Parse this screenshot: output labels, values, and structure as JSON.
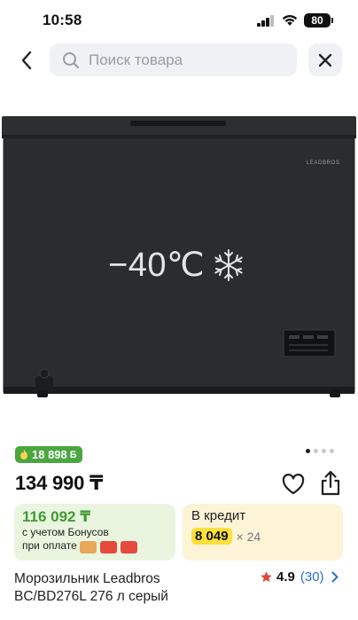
{
  "status_bar": {
    "time": "10:58",
    "battery": "80"
  },
  "header": {
    "search_placeholder": "Поиск товара"
  },
  "product_image": {
    "brand_logo": "LEADBROS",
    "temperature": "−40℃"
  },
  "gallery": {
    "dots": 4,
    "active_dot": 1
  },
  "bonus_badge": {
    "value": "18 898",
    "currency_symbol": "Б"
  },
  "price": "134 990 ₸",
  "bonus_card": {
    "amount": "116 092 ₸",
    "line1": "с учетом Бонусов",
    "line2": "при оплате"
  },
  "credit_card": {
    "title": "В кредит",
    "monthly": "8 049",
    "term": "× 24"
  },
  "product_title": "Морозильник Leadbros BC/BD276L 276 л серый",
  "rating": {
    "value": "4.9",
    "count": "(30)"
  },
  "colors": {
    "accent_green": "#4aa641",
    "price_green": "#3f9b32",
    "link_blue": "#2b6fd6",
    "credit_yellow": "#fde03b",
    "star_red": "#e0463c"
  }
}
